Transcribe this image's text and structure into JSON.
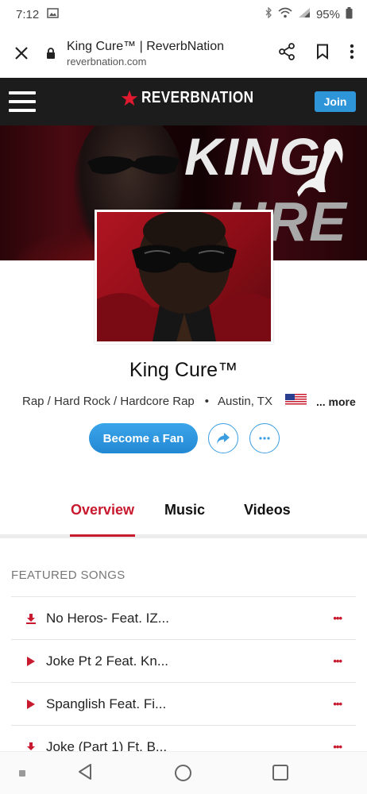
{
  "status_bar": {
    "time": "7:12",
    "battery": "95%",
    "icons": [
      "image-icon",
      "bluetooth-icon",
      "wifi-icon",
      "signal-icon",
      "battery-icon"
    ]
  },
  "browser": {
    "page_title": "King Cure™ | ReverbNation",
    "url": "reverbnation.com"
  },
  "site_header": {
    "logo_text": "REVERBNATION",
    "join_label": "Join",
    "brand_color": "#c8192e",
    "join_color": "#2e95d8"
  },
  "banner": {
    "title_line1": "KING",
    "title_line2": "URE"
  },
  "artist": {
    "name": "King Cure™",
    "genres": "Rap / Hard Rock / Hardcore Rap",
    "location": "Austin, TX",
    "more_label": "... more",
    "become_fan_label": "Become a Fan"
  },
  "tabs": {
    "items": [
      {
        "label": "Overview",
        "active": true
      },
      {
        "label": "Music",
        "active": false
      },
      {
        "label": "Videos",
        "active": false
      }
    ]
  },
  "featured_songs": {
    "title": "FEATURED SONGS",
    "items": [
      {
        "title": "No Heros- Feat. IZ...",
        "icon": "download-icon",
        "more": "•••"
      },
      {
        "title": "Joke Pt 2 Feat. Kn...",
        "icon": "play-icon",
        "more": "•••"
      },
      {
        "title": "Spanglish Feat. Fi...",
        "icon": "play-icon",
        "more": "•••"
      },
      {
        "title": "Joke (Part 1) Ft. B...",
        "icon": "download-icon",
        "more": "•••"
      }
    ]
  }
}
